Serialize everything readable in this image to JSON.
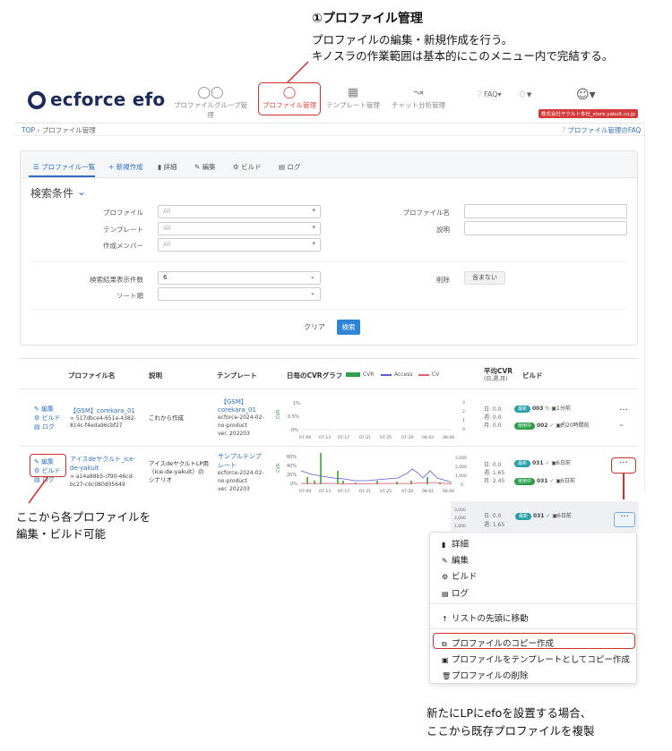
{
  "callout_top": {
    "title": "①プロファイル管理",
    "line1": "プロファイルの編集・新規作成を行う。",
    "line2": "キノスラの作業範囲は基本的にこのメニュー内で完結する。"
  },
  "app": {
    "logo_text": "ecforce efo",
    "nav": [
      {
        "label": "プロファイルグループ管理",
        "icon": "user-group-icon"
      },
      {
        "label": "プロファイル管理",
        "icon": "user-icon",
        "active": true
      },
      {
        "label": "テンプレート管理",
        "icon": "template-icon"
      },
      {
        "label": "チャット分析管理",
        "icon": "chart-icon"
      }
    ],
    "faq_label": "FAQ",
    "company_badge": "株式会社ヤクルト本社_store.yakult.co.jp",
    "accent_color": "#e0453a",
    "link_color": "#2f6fbf"
  },
  "breadcrumb": {
    "top": "TOP",
    "separator": "›",
    "current": "プロファイル管理"
  },
  "faq_link": "プロファイル管理のFAQ",
  "tabs": [
    "プロファイル一覧",
    "新規作成",
    "詳細",
    "編集",
    "ビルド",
    "ログ"
  ],
  "search": {
    "title": "検索条件",
    "profile_label": "プロファイル",
    "profile_value": "All",
    "template_label": "テンプレート",
    "template_value": "All",
    "member_label": "作成メンバー",
    "member_value": "All",
    "name_label": "プロファイル名",
    "desc_label": "説明",
    "count_label": "検索結果表示件数",
    "count_value": "6",
    "sort_label": "ソート順",
    "sort_value": "",
    "delete_label": "削除",
    "delete_value": "含まない",
    "clear_label": "クリア",
    "search_label": "検索"
  },
  "table": {
    "headers": {
      "name": "プロファイル名",
      "desc": "説明",
      "template": "テンプレート",
      "graph": "日毎のCVRグラフ",
      "legend_cvr": "CVR",
      "legend_access": "Access",
      "legend_cv": "CV",
      "avg_cvr": "平均CVR",
      "avg_cvr_sub": "(日,週,月)",
      "build": "ビルド"
    },
    "actions": {
      "edit": "編集",
      "build": "ビルド",
      "log": "ログ"
    },
    "rows": [
      {
        "name": "【GSM】corekara_01",
        "id_line1": "517dbce4-651a-4382-",
        "id_line2": "814c-f4eda96cbf27",
        "desc1": "これから作成",
        "desc2": "",
        "desc3": "",
        "template_name1": "【GSM】",
        "template_name2": "corekara_01",
        "template_id1": "ecforce-2024-02-",
        "template_id2": "no-product",
        "template_ver": "ver. 202203",
        "y_ticks": [
          "1%",
          "0.5%",
          "0%"
        ],
        "x_ticks": [
          "07-09",
          "07-13",
          "07-17",
          "07-21",
          "07-25",
          "07-29",
          "08-02",
          "08-06"
        ],
        "r_ticks": [
          "3",
          "2",
          "1",
          "0"
        ],
        "day": "日: 0.0",
        "week": "週: 0.0",
        "month": "月: 0.0",
        "build1_badge": "最新",
        "build1_num": "003",
        "build1_time": "1分前",
        "build2_badge": "使用中",
        "build2_num": "002",
        "build2_time": "約20時間前"
      },
      {
        "name1": "アイスdeヤクルト_ice-",
        "name2": "de-yakult",
        "id_line1": "a14a88b5-cf90-46cd-",
        "id_line2": "bc27-c6c080d05649",
        "desc1": "アイスdeヤクルトLP用",
        "desc2": "（ice-de-yakult）の",
        "desc3": "シナリオ",
        "template_name1": "サンプルテンプ",
        "template_name2": "レート",
        "template_id1": "ecforce-2024-02-",
        "template_id2": "no-product",
        "template_ver": "ver. 202203",
        "y_ticks": [
          "60%",
          "40%",
          "20%",
          "0%"
        ],
        "x_ticks": [
          "07-09",
          "07-13",
          "07-17",
          "07-21",
          "07-25",
          "07-29",
          "08-02",
          "08-06"
        ],
        "r_ticks": [
          "3,000",
          "2,000",
          "1,000",
          "0"
        ],
        "day": "日: 0.0",
        "week": "週: 1.65",
        "month": "月: 2.45",
        "build1_badge": "最新",
        "build1_num": "031",
        "build1_time": "6日前",
        "build2_badge": "使用中",
        "build2_num": "031",
        "build2_time": "6日前"
      }
    ]
  },
  "note_left": {
    "line1": "ここから各プロファイルを",
    "line2": "編集・ビルド可能"
  },
  "popup": {
    "r_ticks": [
      "3,000",
      "2,000",
      "1,000"
    ],
    "day": "日: 0.0",
    "week": "週: 1.65",
    "badge": "最新",
    "num": "031",
    "time": "6日前",
    "menu": {
      "detail": "詳細",
      "edit": "編集",
      "build": "ビルド",
      "log": "ログ",
      "move_top": "リストの先頭に移動",
      "copy": "プロファイルのコピー作成",
      "copy_template": "プロファイルをテンプレートとしてコピー作成",
      "delete": "プロファイルの削除"
    }
  },
  "note_bottom": {
    "line1": "新たにLPにefoを設置する場合、",
    "line2": "ここから既存プロファイルを複製"
  }
}
